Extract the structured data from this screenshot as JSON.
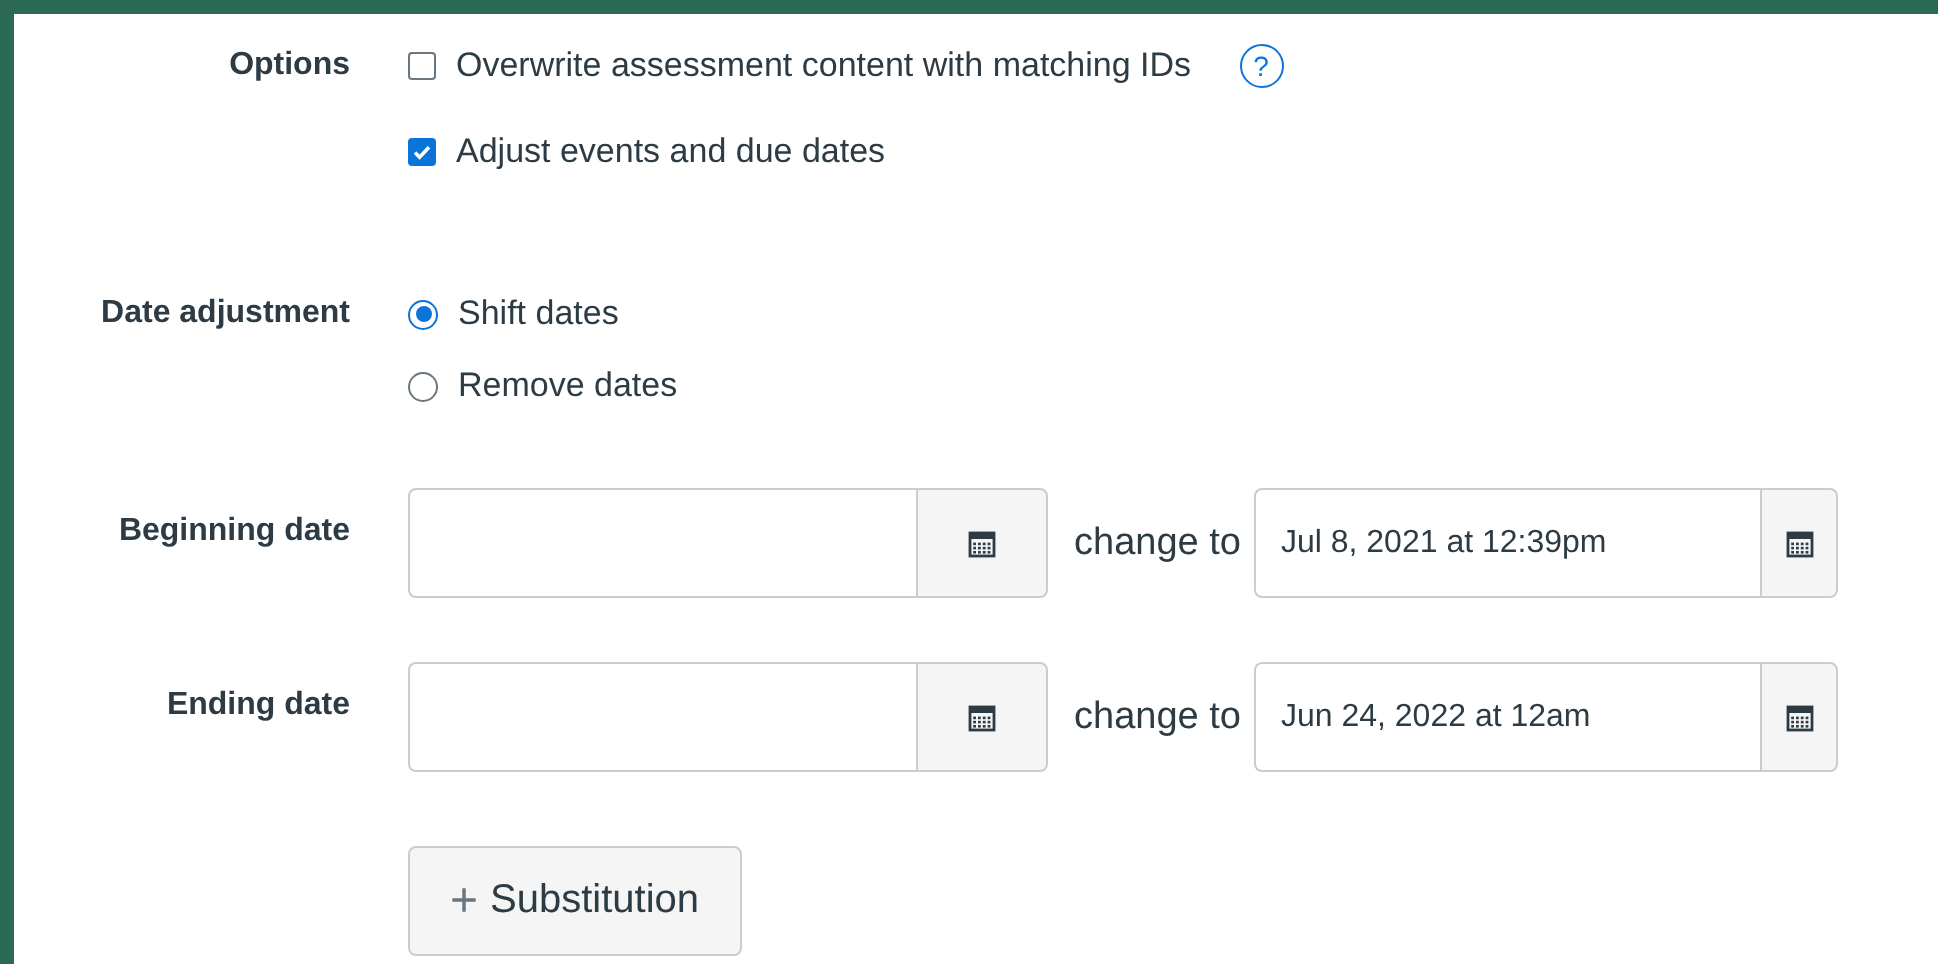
{
  "options": {
    "label": "Options",
    "items": [
      {
        "label": "Overwrite assessment content with matching IDs",
        "checked": false,
        "help": "?"
      },
      {
        "label": "Adjust events and due dates",
        "checked": true
      }
    ]
  },
  "date_adjustment": {
    "label": "Date adjustment",
    "choices": [
      {
        "label": "Shift dates",
        "selected": true
      },
      {
        "label": "Remove dates",
        "selected": false
      }
    ]
  },
  "date_rows": [
    {
      "label": "Beginning date",
      "change_label": "change to",
      "new_value": "Jul 8, 2021 at 12:39pm"
    },
    {
      "label": "Ending date",
      "change_label": "change to",
      "new_value": "Jun 24, 2022 at 12am"
    }
  ],
  "add_button": {
    "icon": "+",
    "label": "Substitution"
  }
}
